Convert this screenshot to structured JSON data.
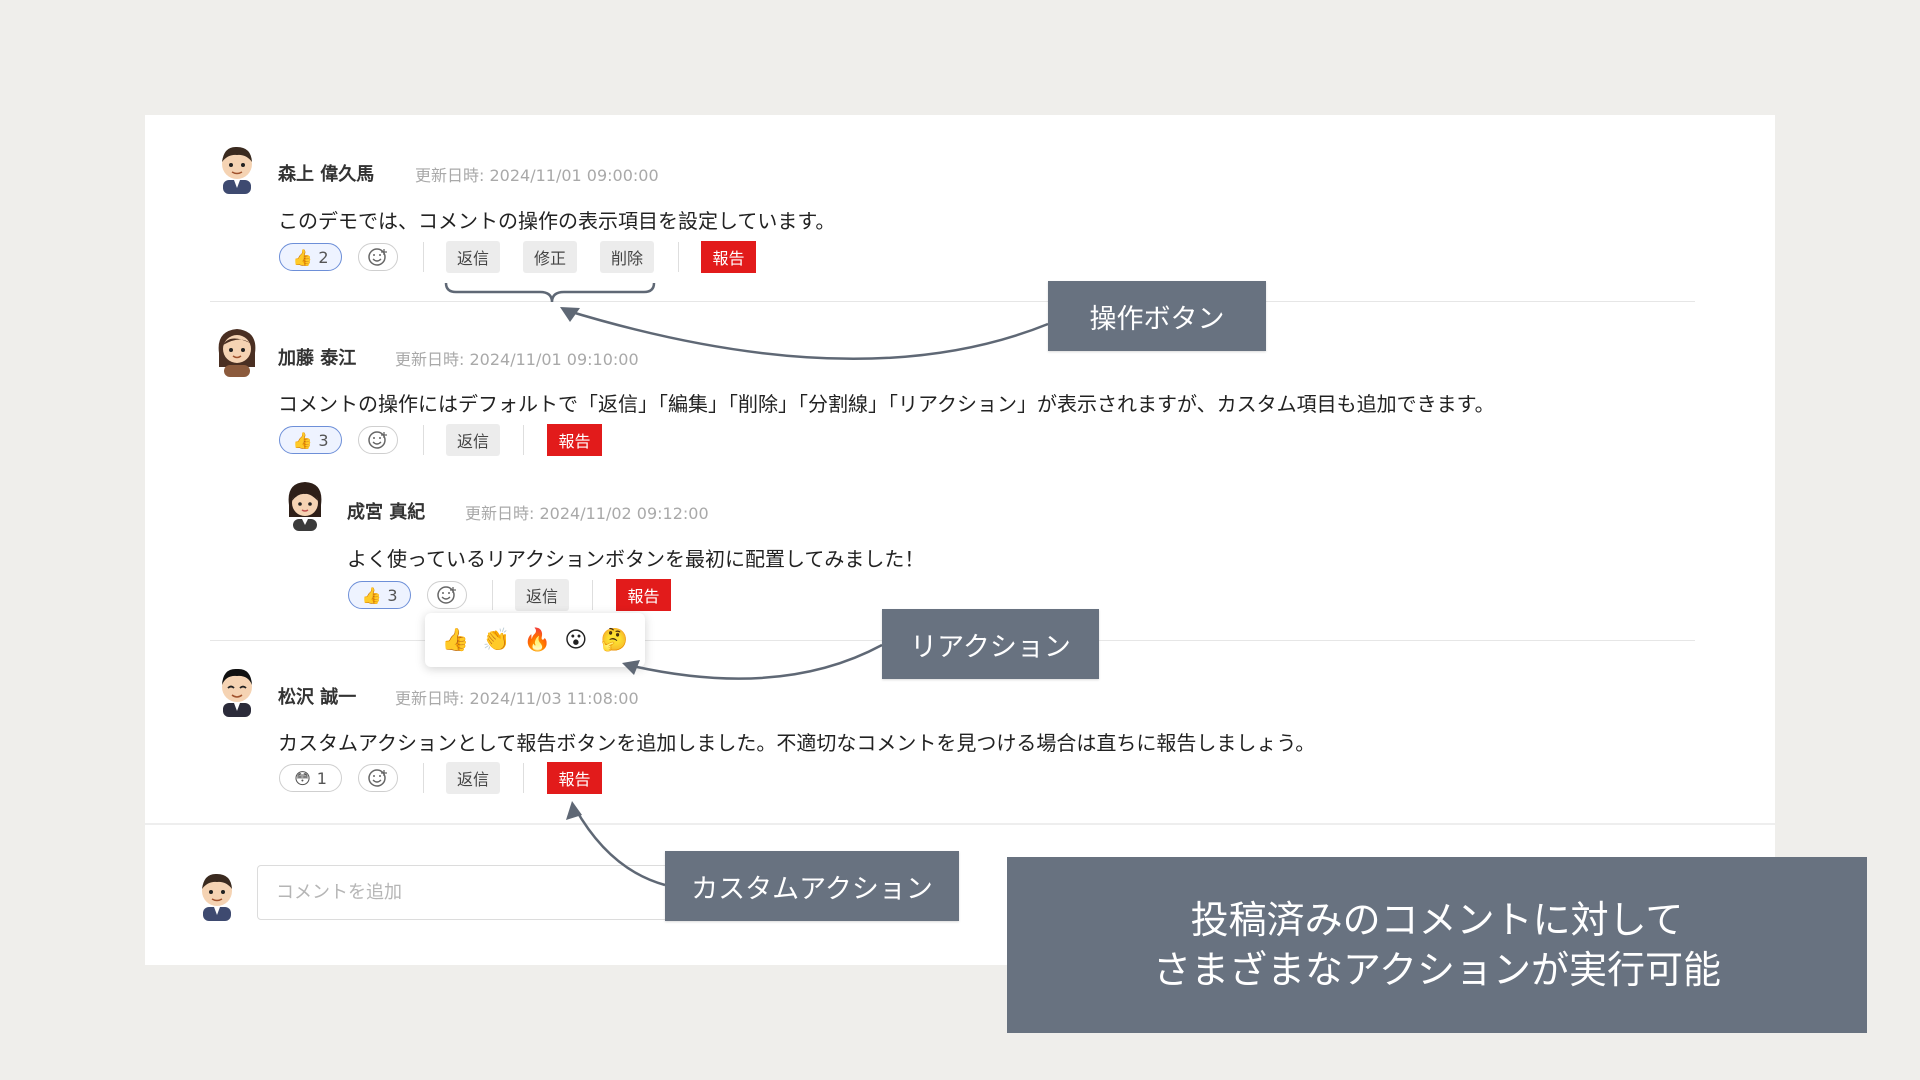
{
  "comments": [
    {
      "author": "森上 偉久馬",
      "updated": "更新日時: 2024/11/01 09:00:00",
      "text": "このデモでは、コメントの操作の表示項目を設定しています。",
      "reaction": {
        "emoji": "👍",
        "count": "2"
      },
      "actions": [
        "返信",
        "修正",
        "削除"
      ],
      "report": "報告"
    },
    {
      "author": "加藤 泰江",
      "updated": "更新日時: 2024/11/01 09:10:00",
      "text": "コメントの操作にはデフォルトで「返信」「編集」「削除」「分割線」「リアクション」が表示されますが、カスタム項目も追加できます。",
      "reaction": {
        "emoji": "👍",
        "count": "3"
      },
      "actions": [
        "返信"
      ],
      "report": "報告"
    },
    {
      "author": "成宮 真紀",
      "updated": "更新日時: 2024/11/02 09:12:00",
      "text": "よく使っているリアクションボタンを最初に配置してみました！",
      "reaction": {
        "emoji": "👍",
        "count": "3"
      },
      "actions": [
        "返信"
      ],
      "report": "報告"
    },
    {
      "author": "松沢 誠一",
      "updated": "更新日時: 2024/11/03 11:08:00",
      "text": "カスタムアクションとして報告ボタンを追加しました。不適切なコメントを見つける場合は直ちに報告しましょう。",
      "reaction": {
        "emoji": "😳",
        "count": "1"
      },
      "actions": [
        "返信"
      ],
      "report": "報告"
    }
  ],
  "reaction_picker": [
    "👍",
    "👏",
    "🔥",
    "😮",
    "🤔"
  ],
  "input": {
    "placeholder": "コメントを追加"
  },
  "callouts": {
    "ops": "操作ボタン",
    "reaction": "リアクション",
    "custom": "カスタムアクション",
    "summary_line1": "投稿済みのコメントに対して",
    "summary_line2": "さまざまなアクションが実行可能"
  },
  "colors": {
    "report_red": "#e21b1b",
    "callout_bg": "#687280",
    "reaction_border": "#6d8fd8"
  }
}
